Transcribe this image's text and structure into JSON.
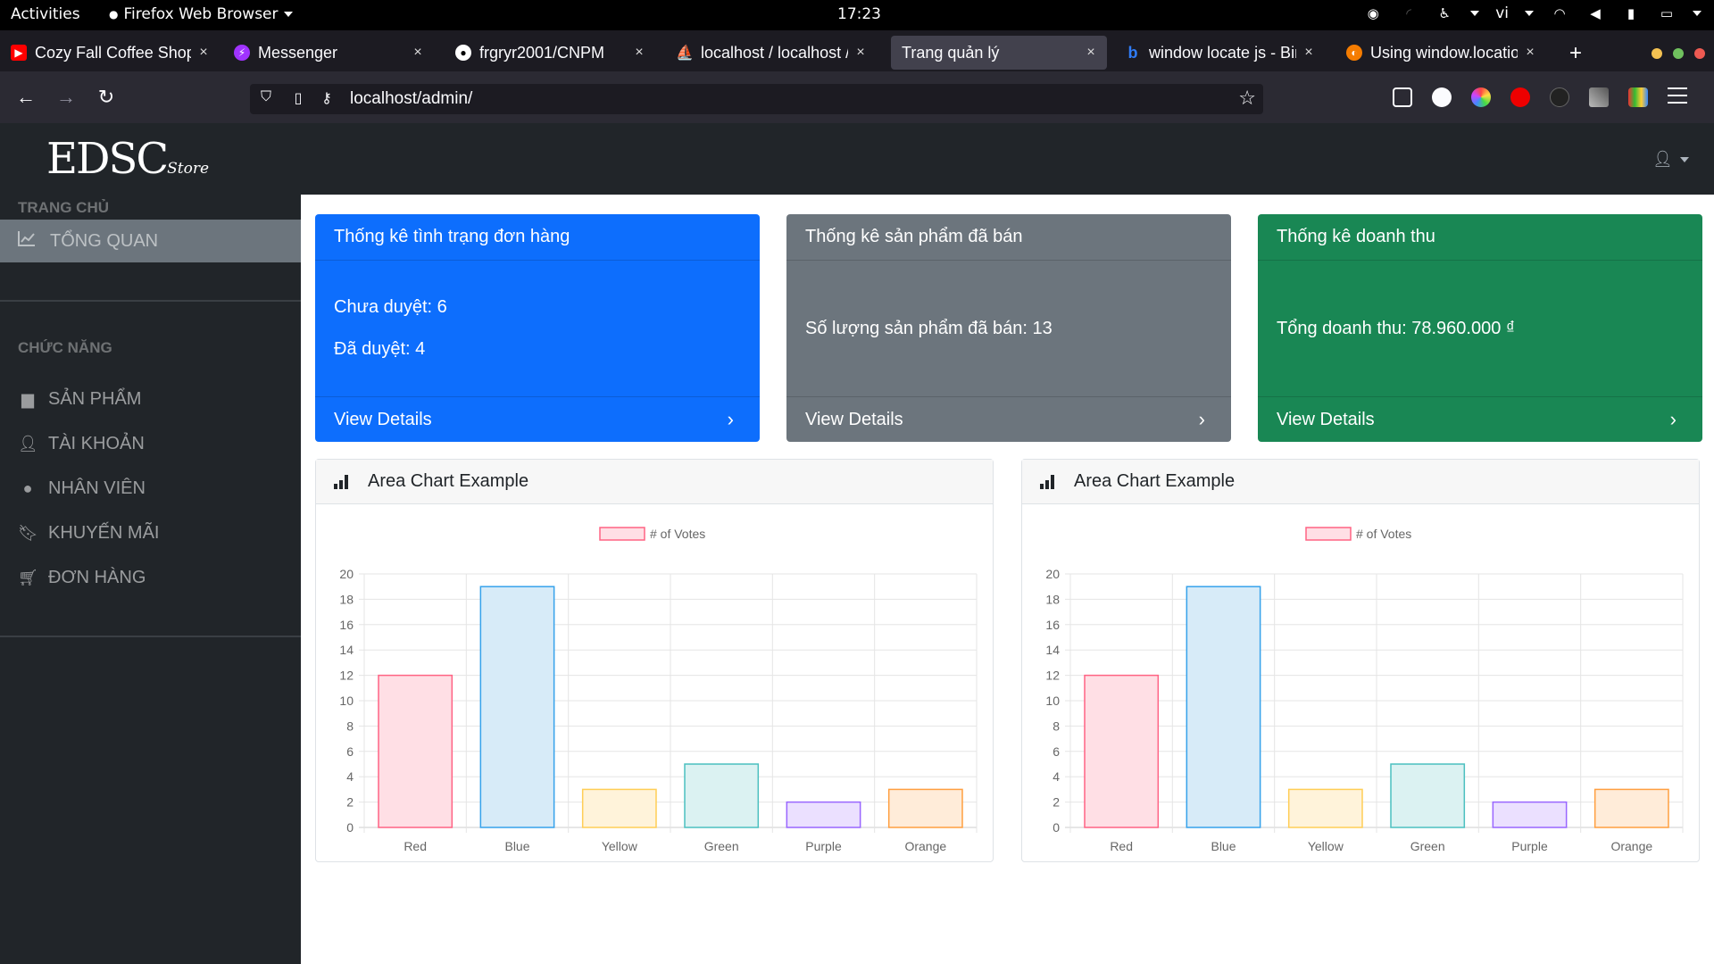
{
  "topbar": {
    "activities": "Activities",
    "app_name": "Firefox Web Browser",
    "clock": "17:23",
    "lang": "vi"
  },
  "tabs": [
    {
      "label": "Cozy Fall Coffee Shop",
      "favicon_color": "#ff0000",
      "icon": "youtube-icon"
    },
    {
      "label": "Messenger",
      "favicon_color": "#a033ff",
      "icon": "messenger-icon"
    },
    {
      "label": "frgryr2001/CNPM",
      "favicon_color": "#ffffff",
      "icon": "github-icon"
    },
    {
      "label": "localhost / localhost / ",
      "favicon_color": "#f29111",
      "icon": "phpmyadmin-icon"
    },
    {
      "label": "Trang quản lý",
      "favicon_color": "",
      "icon": ""
    },
    {
      "label": "window locate js - Bin",
      "favicon_color": "#2f7cf6",
      "icon": "bing-icon"
    },
    {
      "label": "Using window.locatio",
      "favicon_color": "#f57c00",
      "icon": "web-icon"
    }
  ],
  "navbar": {
    "url": "localhost/admin/"
  },
  "app": {
    "logo_main": "EDSC",
    "logo_sub": "Store"
  },
  "sidebar": {
    "heading_home": "TRANG CHỦ",
    "active_item": "TỔNG QUAN",
    "heading_functions": "CHỨC NĂNG",
    "items": [
      {
        "label": "SẢN PHẨM",
        "icon": "store-icon"
      },
      {
        "label": "TÀI KHOẢN",
        "icon": "user-icon"
      },
      {
        "label": "NHÂN VIÊN",
        "icon": "user-circle-icon"
      },
      {
        "label": "KHUYẾN MÃI",
        "icon": "bookmark-icon"
      },
      {
        "label": "ĐƠN HÀNG",
        "icon": "cart-icon"
      }
    ]
  },
  "cards": [
    {
      "title": "Thống kê tình trạng đơn hàng",
      "lines": [
        "Chưa duyệt: 6",
        "Đã duyệt: 4"
      ],
      "footer": "View Details",
      "color": "#0d6efd"
    },
    {
      "title": "Thống kê sản phẩm đã bán",
      "lines": [
        "Số lượng sản phẩm đã bán: 13"
      ],
      "footer": "View Details",
      "color": "#6c757d"
    },
    {
      "title": "Thống kê doanh thu",
      "lines": [
        "Tổng doanh thu: 78.960.000 ₫"
      ],
      "footer": "View Details",
      "color": "#198754"
    }
  ],
  "chart_cards": [
    {
      "title": "Area Chart Example"
    },
    {
      "title": "Area Chart Example"
    }
  ],
  "chart_data": [
    {
      "type": "bar",
      "legend": "# of Votes",
      "legend_position": "top-center",
      "categories": [
        "Red",
        "Blue",
        "Yellow",
        "Green",
        "Purple",
        "Orange"
      ],
      "values": [
        12,
        19,
        3,
        5,
        2,
        3
      ],
      "ylim": [
        0,
        20
      ],
      "yticks": [
        0,
        2,
        4,
        6,
        8,
        10,
        12,
        14,
        16,
        18,
        20
      ],
      "grid": true,
      "fill_colors": [
        "#ffdfe5",
        "#d7ebf8",
        "#fff3da",
        "#dbf2f2",
        "#ebe0ff",
        "#ffecd9"
      ],
      "border_colors": [
        "#ff6384",
        "#36a2eb",
        "#ffce56",
        "#4bc0c0",
        "#9966ff",
        "#ff9f40"
      ]
    },
    {
      "type": "bar",
      "legend": "# of Votes",
      "legend_position": "top-center",
      "categories": [
        "Red",
        "Blue",
        "Yellow",
        "Green",
        "Purple",
        "Orange"
      ],
      "values": [
        12,
        19,
        3,
        5,
        2,
        3
      ],
      "ylim": [
        0,
        20
      ],
      "yticks": [
        0,
        2,
        4,
        6,
        8,
        10,
        12,
        14,
        16,
        18,
        20
      ],
      "grid": true,
      "fill_colors": [
        "#ffdfe5",
        "#d7ebf8",
        "#fff3da",
        "#dbf2f2",
        "#ebe0ff",
        "#ffecd9"
      ],
      "border_colors": [
        "#ff6384",
        "#36a2eb",
        "#ffce56",
        "#4bc0c0",
        "#9966ff",
        "#ff9f40"
      ]
    }
  ]
}
